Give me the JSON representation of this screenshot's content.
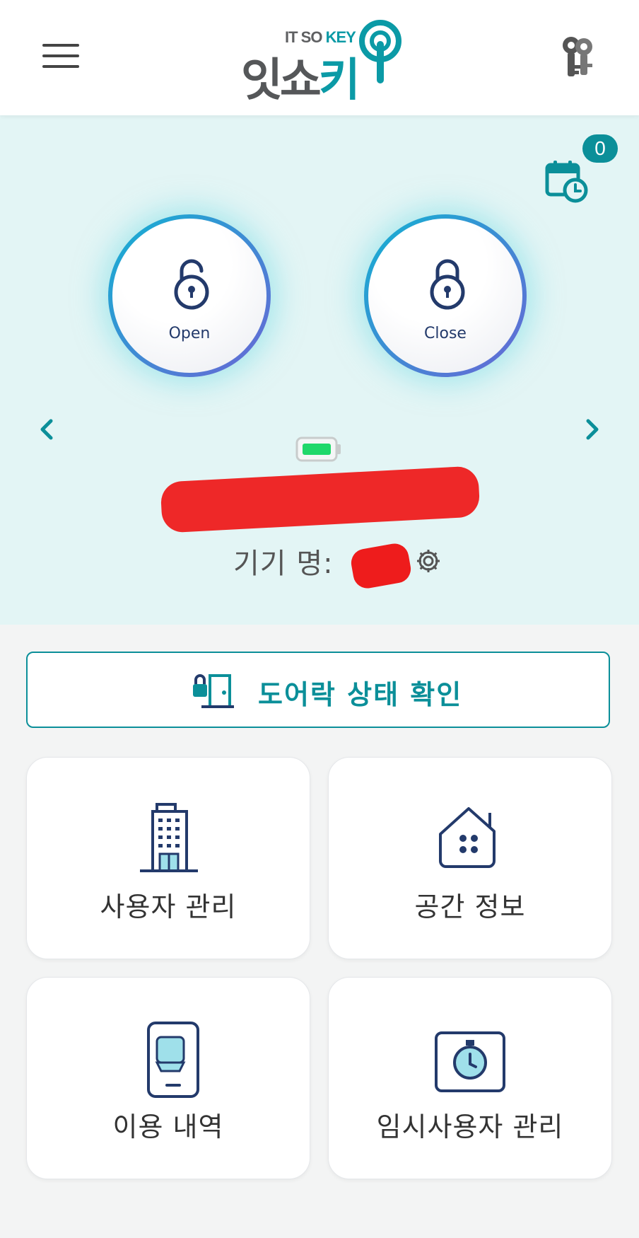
{
  "header": {
    "logo_top_it": "IT SO ",
    "logo_top_key": "KEY",
    "logo_main": "잇쇼",
    "logo_main_ki": "키"
  },
  "hero": {
    "schedule_badge": "0",
    "open_label": "Open",
    "close_label": "Close",
    "device_label": "기기 명:",
    "battery_color": "#1fd86a"
  },
  "actions": {
    "doorlock_status": "도어락 상태 확인"
  },
  "menu": [
    {
      "label": "사용자 관리",
      "icon": "building-icon"
    },
    {
      "label": "공간 정보",
      "icon": "home-icon"
    },
    {
      "label": "이용 내역",
      "icon": "phone-history-icon"
    },
    {
      "label": "임시사용자 관리",
      "icon": "timer-icon"
    }
  ],
  "colors": {
    "accent": "#0b8f99",
    "hero_bg": "#e3f5f5",
    "navy": "#233a6b"
  }
}
